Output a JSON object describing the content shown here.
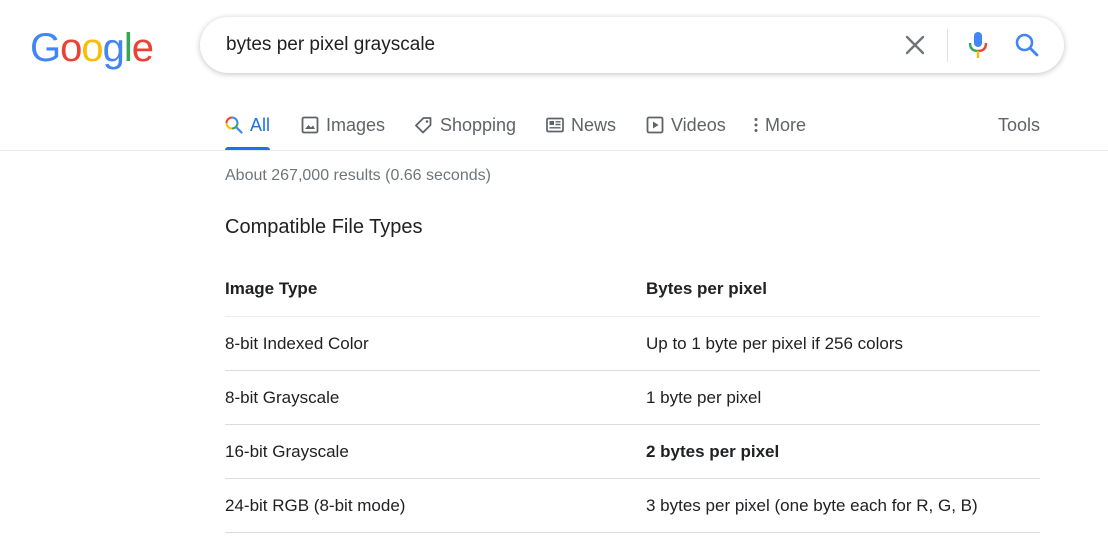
{
  "logo": {
    "letters": [
      {
        "ch": "G",
        "color": "#4285f4"
      },
      {
        "ch": "o",
        "color": "#ea4335"
      },
      {
        "ch": "o",
        "color": "#fbbc05"
      },
      {
        "ch": "g",
        "color": "#4285f4"
      },
      {
        "ch": "l",
        "color": "#34a853"
      },
      {
        "ch": "e",
        "color": "#ea4335"
      }
    ]
  },
  "search": {
    "query": "bytes per pixel grayscale"
  },
  "tabs": {
    "all": "All",
    "images": "Images",
    "shopping": "Shopping",
    "news": "News",
    "videos": "Videos",
    "more": "More",
    "tools": "Tools"
  },
  "results": {
    "stats": "About 267,000 results (0.66 seconds)",
    "section_title": "Compatible File Types"
  },
  "table": {
    "headers": [
      "Image Type",
      "Bytes per pixel"
    ],
    "rows": [
      [
        "8-bit Indexed Color",
        "Up to 1 byte per pixel if 256 colors"
      ],
      [
        "8-bit Grayscale",
        "1 byte per pixel"
      ],
      [
        "16-bit Grayscale",
        "2 bytes per pixel"
      ],
      [
        "24-bit RGB (8-bit mode)",
        "3 bytes per pixel (one byte each for R, G, B)"
      ]
    ]
  },
  "colors": {
    "accent": "#1a73e8",
    "muted": "#5f6368",
    "text": "#202124"
  }
}
